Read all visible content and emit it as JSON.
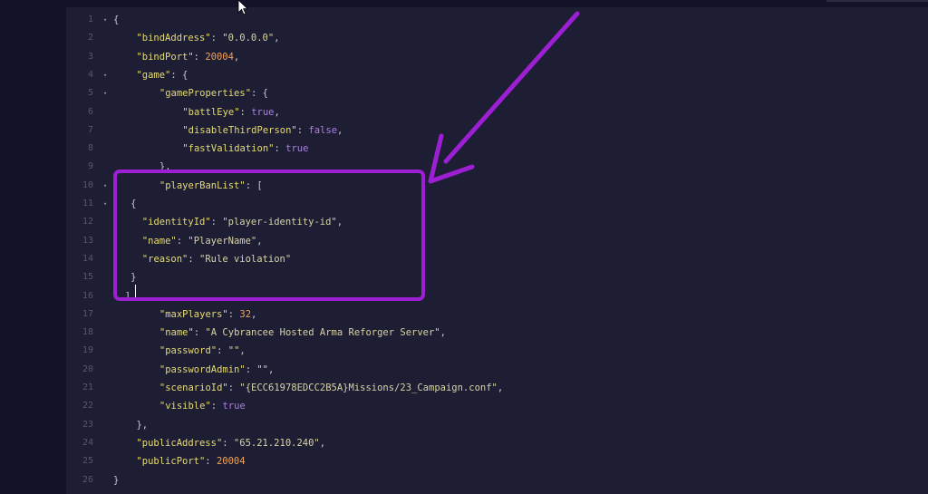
{
  "editor": {
    "lines": [
      {
        "num": "1",
        "fold": true,
        "indent": 0,
        "tokens": [
          {
            "t": "{",
            "c": "p"
          }
        ]
      },
      {
        "num": "2",
        "fold": false,
        "indent": 4,
        "tokens": [
          {
            "t": "\"bindAddress\"",
            "c": "k"
          },
          {
            "t": ": ",
            "c": "p"
          },
          {
            "t": "\"0.0.0.0\"",
            "c": "s"
          },
          {
            "t": ",",
            "c": "p"
          }
        ]
      },
      {
        "num": "3",
        "fold": false,
        "indent": 4,
        "tokens": [
          {
            "t": "\"bindPort\"",
            "c": "k"
          },
          {
            "t": ": ",
            "c": "p"
          },
          {
            "t": "20004",
            "c": "n"
          },
          {
            "t": ",",
            "c": "p"
          }
        ]
      },
      {
        "num": "4",
        "fold": true,
        "indent": 4,
        "tokens": [
          {
            "t": "\"game\"",
            "c": "k"
          },
          {
            "t": ": {",
            "c": "p"
          }
        ]
      },
      {
        "num": "5",
        "fold": true,
        "indent": 8,
        "tokens": [
          {
            "t": "\"gameProperties\"",
            "c": "k"
          },
          {
            "t": ": {",
            "c": "p"
          }
        ]
      },
      {
        "num": "6",
        "fold": false,
        "indent": 12,
        "tokens": [
          {
            "t": "\"battlEye\"",
            "c": "k"
          },
          {
            "t": ": ",
            "c": "p"
          },
          {
            "t": "true",
            "c": "b"
          },
          {
            "t": ",",
            "c": "p"
          }
        ]
      },
      {
        "num": "7",
        "fold": false,
        "indent": 12,
        "tokens": [
          {
            "t": "\"disableThirdPerson\"",
            "c": "k"
          },
          {
            "t": ": ",
            "c": "p"
          },
          {
            "t": "false",
            "c": "b"
          },
          {
            "t": ",",
            "c": "p"
          }
        ]
      },
      {
        "num": "8",
        "fold": false,
        "indent": 12,
        "tokens": [
          {
            "t": "\"fastValidation\"",
            "c": "k"
          },
          {
            "t": ": ",
            "c": "p"
          },
          {
            "t": "true",
            "c": "b"
          }
        ]
      },
      {
        "num": "9",
        "fold": false,
        "indent": 8,
        "tokens": [
          {
            "t": "},",
            "c": "p"
          }
        ]
      },
      {
        "num": "10",
        "fold": true,
        "indent": 8,
        "tokens": [
          {
            "t": "\"playerBanList\"",
            "c": "k"
          },
          {
            "t": ": [",
            "c": "p"
          }
        ]
      },
      {
        "num": "11",
        "fold": true,
        "indent": 3,
        "tokens": [
          {
            "t": "{",
            "c": "p"
          }
        ]
      },
      {
        "num": "12",
        "fold": false,
        "indent": 5,
        "tokens": [
          {
            "t": "\"identityId\"",
            "c": "k"
          },
          {
            "t": ": ",
            "c": "p"
          },
          {
            "t": "\"player-identity-id\"",
            "c": "s"
          },
          {
            "t": ",",
            "c": "p"
          }
        ]
      },
      {
        "num": "13",
        "fold": false,
        "indent": 5,
        "tokens": [
          {
            "t": "\"name\"",
            "c": "k"
          },
          {
            "t": ": ",
            "c": "p"
          },
          {
            "t": "\"PlayerName\"",
            "c": "s"
          },
          {
            "t": ",",
            "c": "p"
          }
        ]
      },
      {
        "num": "14",
        "fold": false,
        "indent": 5,
        "tokens": [
          {
            "t": "\"reason\"",
            "c": "k"
          },
          {
            "t": ": ",
            "c": "p"
          },
          {
            "t": "\"Rule violation\"",
            "c": "s"
          }
        ]
      },
      {
        "num": "15",
        "fold": false,
        "indent": 3,
        "tokens": [
          {
            "t": "}",
            "c": "p"
          }
        ]
      },
      {
        "num": "16",
        "fold": false,
        "indent": 2,
        "tokens": [
          {
            "t": "],",
            "c": "p"
          }
        ]
      },
      {
        "num": "17",
        "fold": false,
        "indent": 8,
        "tokens": [
          {
            "t": "\"maxPlayers\"",
            "c": "k"
          },
          {
            "t": ": ",
            "c": "p"
          },
          {
            "t": "32",
            "c": "n"
          },
          {
            "t": ",",
            "c": "p"
          }
        ]
      },
      {
        "num": "18",
        "fold": false,
        "indent": 8,
        "tokens": [
          {
            "t": "\"name\"",
            "c": "k"
          },
          {
            "t": ": ",
            "c": "p"
          },
          {
            "t": "\"A Cybrancee Hosted Arma Reforger Server\"",
            "c": "s"
          },
          {
            "t": ",",
            "c": "p"
          }
        ]
      },
      {
        "num": "19",
        "fold": false,
        "indent": 8,
        "tokens": [
          {
            "t": "\"password\"",
            "c": "k"
          },
          {
            "t": ": ",
            "c": "p"
          },
          {
            "t": "\"\"",
            "c": "s"
          },
          {
            "t": ",",
            "c": "p"
          }
        ]
      },
      {
        "num": "20",
        "fold": false,
        "indent": 8,
        "tokens": [
          {
            "t": "\"passwordAdmin\"",
            "c": "k"
          },
          {
            "t": ": ",
            "c": "p"
          },
          {
            "t": "\"\"",
            "c": "s"
          },
          {
            "t": ",",
            "c": "p"
          }
        ]
      },
      {
        "num": "21",
        "fold": false,
        "indent": 8,
        "tokens": [
          {
            "t": "\"scenarioId\"",
            "c": "k"
          },
          {
            "t": ": ",
            "c": "p"
          },
          {
            "t": "\"{ECC61978EDCC2B5A}Missions/23_Campaign.conf\"",
            "c": "s"
          },
          {
            "t": ",",
            "c": "p"
          }
        ]
      },
      {
        "num": "22",
        "fold": false,
        "indent": 8,
        "tokens": [
          {
            "t": "\"visible\"",
            "c": "k"
          },
          {
            "t": ": ",
            "c": "p"
          },
          {
            "t": "true",
            "c": "b"
          }
        ]
      },
      {
        "num": "23",
        "fold": false,
        "indent": 4,
        "tokens": [
          {
            "t": "},",
            "c": "p"
          }
        ]
      },
      {
        "num": "24",
        "fold": false,
        "indent": 4,
        "tokens": [
          {
            "t": "\"publicAddress\"",
            "c": "k"
          },
          {
            "t": ": ",
            "c": "p"
          },
          {
            "t": "\"65.21.210.240\"",
            "c": "s"
          },
          {
            "t": ",",
            "c": "p"
          }
        ]
      },
      {
        "num": "25",
        "fold": false,
        "indent": 4,
        "tokens": [
          {
            "t": "\"publicPort\"",
            "c": "k"
          },
          {
            "t": ": ",
            "c": "p"
          },
          {
            "t": "20004",
            "c": "n"
          }
        ]
      },
      {
        "num": "26",
        "fold": false,
        "indent": 0,
        "tokens": [
          {
            "t": "}",
            "c": "p"
          }
        ]
      }
    ]
  },
  "annotation": {
    "color": "#9d1fd3"
  },
  "icons": {
    "fold": "fold-arrow-icon",
    "cursor": "mouse-cursor-icon"
  }
}
